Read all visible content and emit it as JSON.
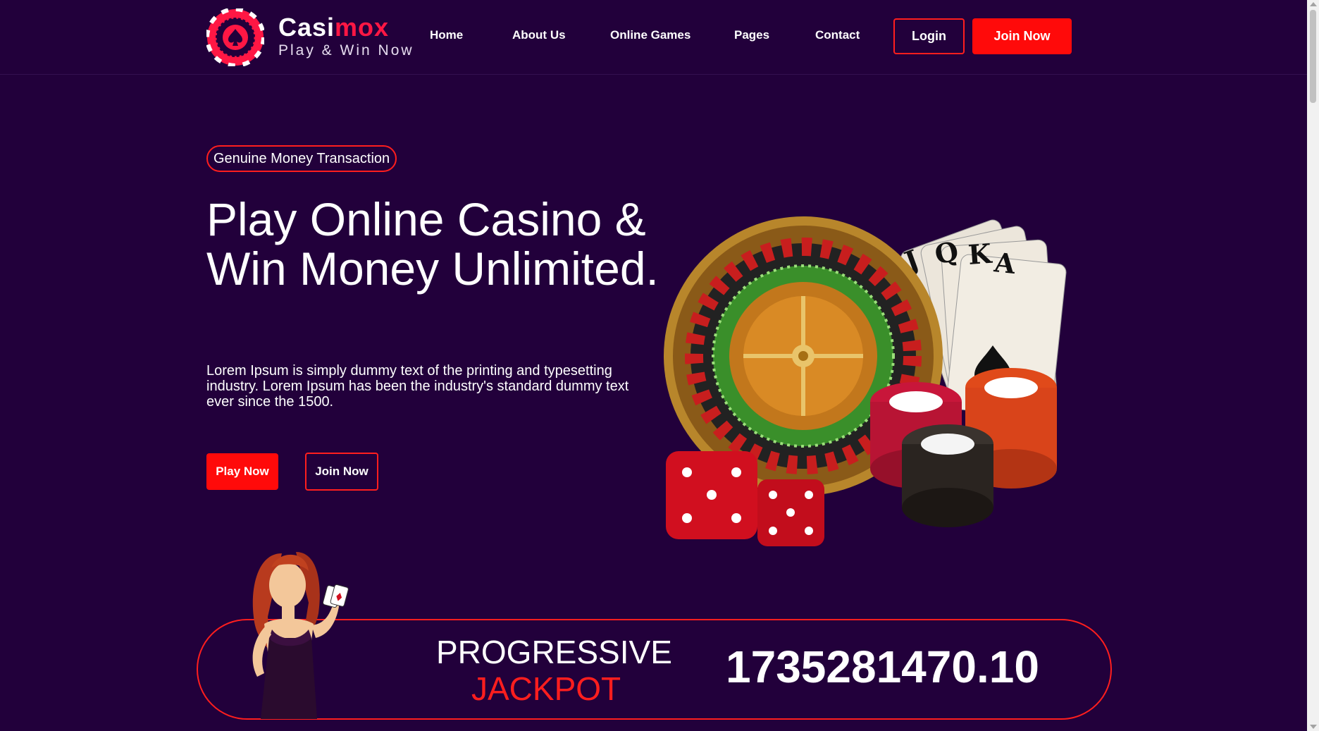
{
  "brand": {
    "part1": "Casi",
    "part2": "mox",
    "tagline": "Play & Win Now"
  },
  "nav": {
    "items": [
      {
        "label": "Home"
      },
      {
        "label": "About Us"
      },
      {
        "label": "Online Games"
      },
      {
        "label": "Pages"
      },
      {
        "label": "Contact"
      }
    ],
    "login_label": "Login",
    "join_label": "Join Now"
  },
  "hero": {
    "badge": "Genuine Money Transaction",
    "title": "Play Online Casino & Win Money Unlimited.",
    "description": "Lorem Ipsum is simply dummy text of the printing and typesetting industry. Lorem Ipsum has been the industry's standard dummy text ever since the 1500.",
    "play_label": "Play Now",
    "join_label": "Join Now"
  },
  "jackpot": {
    "label_line1": "PROGRESSIVE",
    "label_line2": "JACKPOT",
    "amount": "1735281470.10"
  },
  "colors": {
    "background": "#22003b",
    "accent": "#ff0a0a"
  }
}
